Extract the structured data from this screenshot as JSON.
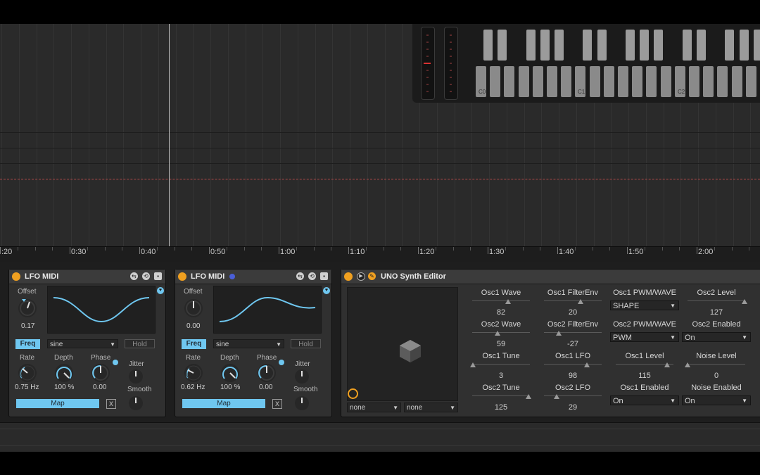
{
  "timeline": {
    "labels": [
      ":20",
      "0:30",
      "0:40",
      "0:50",
      "1:00",
      "1:10",
      "1:20",
      "1:30",
      "1:40",
      "1:50",
      "2:00"
    ]
  },
  "keyboard": {
    "labels": [
      "C0",
      "C1",
      "C2"
    ]
  },
  "lfo1": {
    "title": "LFO MIDI",
    "offset_label": "Offset",
    "offset_value": "0.17",
    "mode_label": "Freq",
    "shape": "sine",
    "hold_label": "Hold",
    "rate_label": "Rate",
    "rate_value": "0.75 Hz",
    "depth_label": "Depth",
    "depth_value": "100 %",
    "phase_label": "Phase",
    "phase_value": "0.00",
    "jitter_label": "Jitter",
    "smooth_label": "Smooth",
    "map_label": "Map",
    "x_label": "X"
  },
  "lfo2": {
    "title": "LFO MIDI",
    "offset_label": "Offset",
    "offset_value": "0.00",
    "mode_label": "Freq",
    "shape": "sine",
    "hold_label": "Hold",
    "rate_label": "Rate",
    "rate_value": "0.62 Hz",
    "depth_label": "Depth",
    "depth_value": "100 %",
    "phase_label": "Phase",
    "phase_value": "0.00",
    "jitter_label": "Jitter",
    "smooth_label": "Smooth",
    "map_label": "Map",
    "x_label": "X"
  },
  "uno": {
    "title": "UNO Synth Editor",
    "xy_x_select": "none",
    "xy_y_select": "none",
    "params": {
      "osc1_wave": {
        "label": "Osc1 Wave",
        "value": "82"
      },
      "osc2_wave": {
        "label": "Osc2 Wave",
        "value": "59"
      },
      "osc1_tune": {
        "label": "Osc1 Tune",
        "value": "3"
      },
      "osc2_tune": {
        "label": "Osc2 Tune",
        "value": "125"
      },
      "osc1_filterenv": {
        "label": "Osc1 FilterEnv",
        "value": "20"
      },
      "osc2_filterenv": {
        "label": "Osc2 FilterEnv",
        "value": "-27"
      },
      "osc1_lfo": {
        "label": "Osc1 LFO",
        "value": "98"
      },
      "osc2_lfo": {
        "label": "Osc2 LFO",
        "value": "29"
      },
      "osc1_pwm": {
        "label": "Osc1 PWM/WAVE",
        "value": "SHAPE"
      },
      "osc2_pwm": {
        "label": "Osc2 PWM/WAVE",
        "value": "PWM"
      },
      "osc1_level": {
        "label": "Osc1 Level",
        "value": "115"
      },
      "osc1_enabled": {
        "label": "Osc1 Enabled",
        "value": "On"
      },
      "osc2_level": {
        "label": "Osc2 Level",
        "value": "127"
      },
      "osc2_enabled": {
        "label": "Osc2 Enabled",
        "value": "On"
      },
      "noise_level": {
        "label": "Noise Level",
        "value": "0"
      },
      "noise_enabled": {
        "label": "Noise Enabled",
        "value": "On"
      }
    }
  },
  "colors": {
    "accent": "#6fc7f0",
    "power": "#f0a020"
  }
}
